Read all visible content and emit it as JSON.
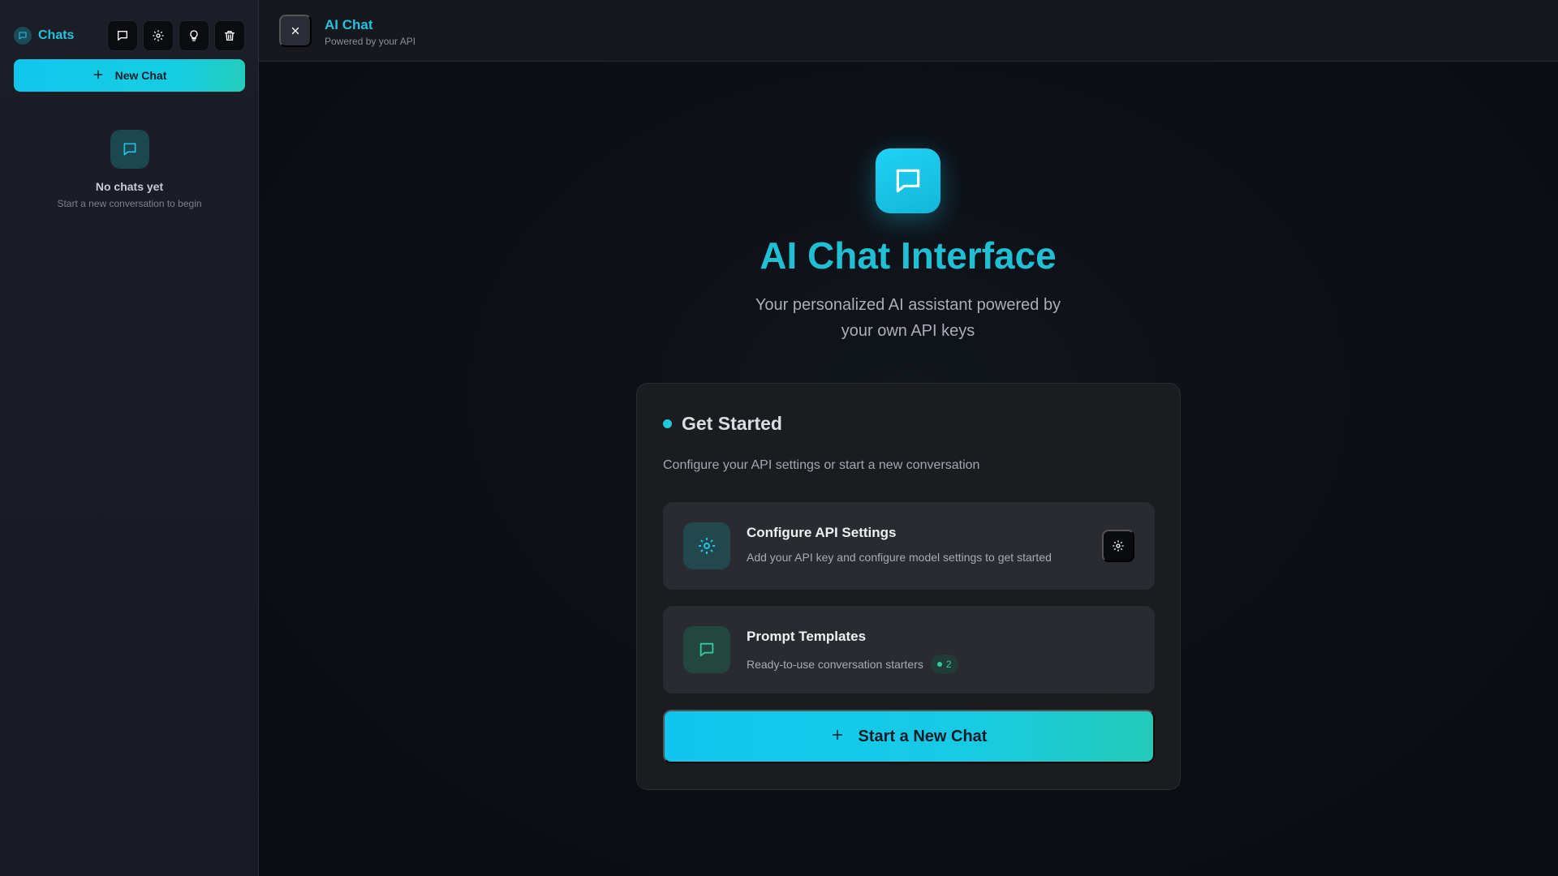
{
  "sidebar": {
    "title": "Chats",
    "tools": [
      {
        "icon": "chat-bubble-icon"
      },
      {
        "icon": "gear-icon"
      },
      {
        "icon": "lightbulb-icon"
      },
      {
        "icon": "trash-icon"
      }
    ],
    "new_chat_label": "New Chat",
    "empty_title": "No chats yet",
    "empty_subtitle": "Start a new conversation to begin"
  },
  "topbar": {
    "title": "AI Chat",
    "subtitle": "Powered by your API"
  },
  "hero": {
    "title": "AI Chat Interface",
    "subtitle": "Your personalized AI assistant powered by your own API keys"
  },
  "card": {
    "title": "Get Started",
    "subtitle": "Configure your API settings or start a new conversation",
    "options": [
      {
        "title": "Configure API Settings",
        "description": "Add your API key and configure model settings to get started",
        "icon": "gear-icon"
      },
      {
        "title": "Prompt Templates",
        "description": "Ready-to-use conversation starters",
        "icon": "chat-bubble-icon",
        "badge": "2"
      }
    ],
    "start_label": "Start a New Chat"
  },
  "colors": {
    "accent": "#22c3df",
    "accent_teal": "#21cdbb",
    "background": "#0b0e13",
    "sidebar": "#1b1d27",
    "card": "#1b1c20"
  }
}
